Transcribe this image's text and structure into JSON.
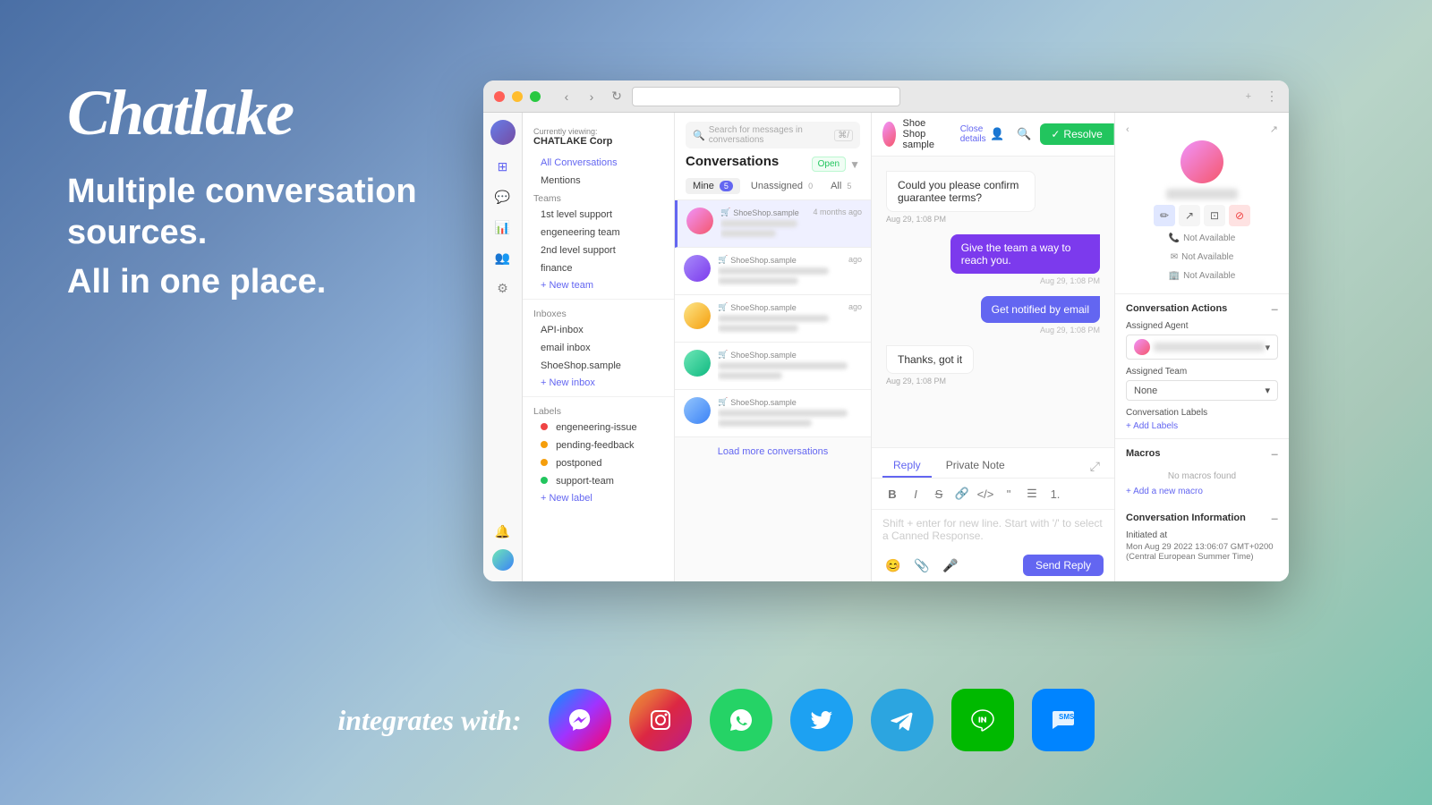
{
  "app": {
    "name": "Chatlake",
    "tagline1": "Multiple conversation sources.",
    "tagline2": "All in one place.",
    "integrates_label": "integrates with:"
  },
  "browser": {
    "tab_new": "+",
    "viewing_label": "Currently viewing:",
    "company": "CHATLAKE Corp"
  },
  "search": {
    "placeholder": "Search for messages in conversations"
  },
  "conversations": {
    "title": "Conversations",
    "open_label": "Open",
    "tabs": [
      {
        "label": "Mine",
        "count": "5"
      },
      {
        "label": "Unassigned",
        "count": "0"
      },
      {
        "label": "All",
        "count": "5"
      }
    ],
    "load_more": "Load more conversations",
    "items": [
      {
        "source": "ShoeShop.sample",
        "time": "4 months ago"
      },
      {
        "source": "ShoeShop.sample",
        "time": "ago"
      },
      {
        "source": "ShoeShop.sample",
        "time": "ago"
      },
      {
        "source": "ShoeShop.sample",
        "time": ""
      },
      {
        "source": "ShoeShop.sample",
        "time": ""
      }
    ]
  },
  "left_panel": {
    "viewing_label": "Currently viewing:",
    "company": "CHATLAKE Corp",
    "all_conversations": "All Conversations",
    "mentions": "Mentions",
    "teams_header": "Teams",
    "teams": [
      "1st level support",
      "engeneering team",
      "2nd level support",
      "finance"
    ],
    "new_team": "+ New team",
    "inboxes_header": "Inboxes",
    "inboxes": [
      "API-inbox",
      "email inbox",
      "ShoeShop.sample"
    ],
    "new_inbox": "+ New inbox",
    "labels_header": "Labels",
    "labels": [
      {
        "name": "engeneering-issue",
        "color": "#ef4444"
      },
      {
        "name": "pending-feedback",
        "color": "#f59e0b"
      },
      {
        "name": "postponed",
        "color": "#f59e0b"
      },
      {
        "name": "support-team",
        "color": "#22c55e"
      }
    ],
    "new_label": "+ New label"
  },
  "chat": {
    "contact_name": "Shoe Shop sample",
    "close_details": "Close details",
    "messages": [
      {
        "type": "incoming",
        "text": "Could you please confirm guarantee terms?",
        "time": "Aug 29, 1:08 PM"
      },
      {
        "type": "outgoing_purple",
        "text": "Give the team a way to reach you.",
        "time": "Aug 29, 1:08 PM"
      },
      {
        "type": "outgoing_blue",
        "text": "Get notified by email",
        "time": "Aug 29, 1:08 PM"
      },
      {
        "type": "incoming",
        "text": "Thanks, got it",
        "time": "Aug 29, 1:08 PM"
      }
    ],
    "composer": {
      "reply_tab": "Reply",
      "private_note_tab": "Private Note",
      "placeholder": "Shift + enter for new line. Start with '/' to select a Canned Response.",
      "send_label": "Send Reply"
    }
  },
  "right_panel": {
    "not_available1": "Not Available",
    "not_available2": "Not Available",
    "not_available3": "Not Available",
    "conv_actions_title": "Conversation Actions",
    "assigned_agent_label": "Assigned Agent",
    "assigned_team_label": "Assigned Team",
    "assigned_team_value": "None",
    "conv_labels_title": "Conversation Labels",
    "add_labels": "+ Add Labels",
    "macros_title": "Macros",
    "no_macros": "No macros found",
    "add_macro": "+ Add a new macro",
    "conv_info_title": "Conversation Information",
    "initiated_at_label": "Initiated at",
    "initiated_at_value": "Mon Aug 29 2022 13:06:07 GMT+0200 (Central European Summer Time)"
  },
  "resolve_btn": {
    "label": "Resolve",
    "check": "✓"
  },
  "social_icons": [
    {
      "name": "messenger",
      "css_class": "icon-messenger",
      "symbol": "m"
    },
    {
      "name": "instagram",
      "css_class": "icon-instagram",
      "symbol": "📷"
    },
    {
      "name": "whatsapp",
      "css_class": "icon-whatsapp",
      "symbol": "📱"
    },
    {
      "name": "twitter",
      "css_class": "icon-twitter",
      "symbol": "🐦"
    },
    {
      "name": "telegram",
      "css_class": "icon-telegram",
      "symbol": "✈"
    },
    {
      "name": "line",
      "css_class": "icon-line",
      "symbol": "L"
    },
    {
      "name": "sms",
      "css_class": "icon-sms",
      "symbol": "💬"
    }
  ]
}
